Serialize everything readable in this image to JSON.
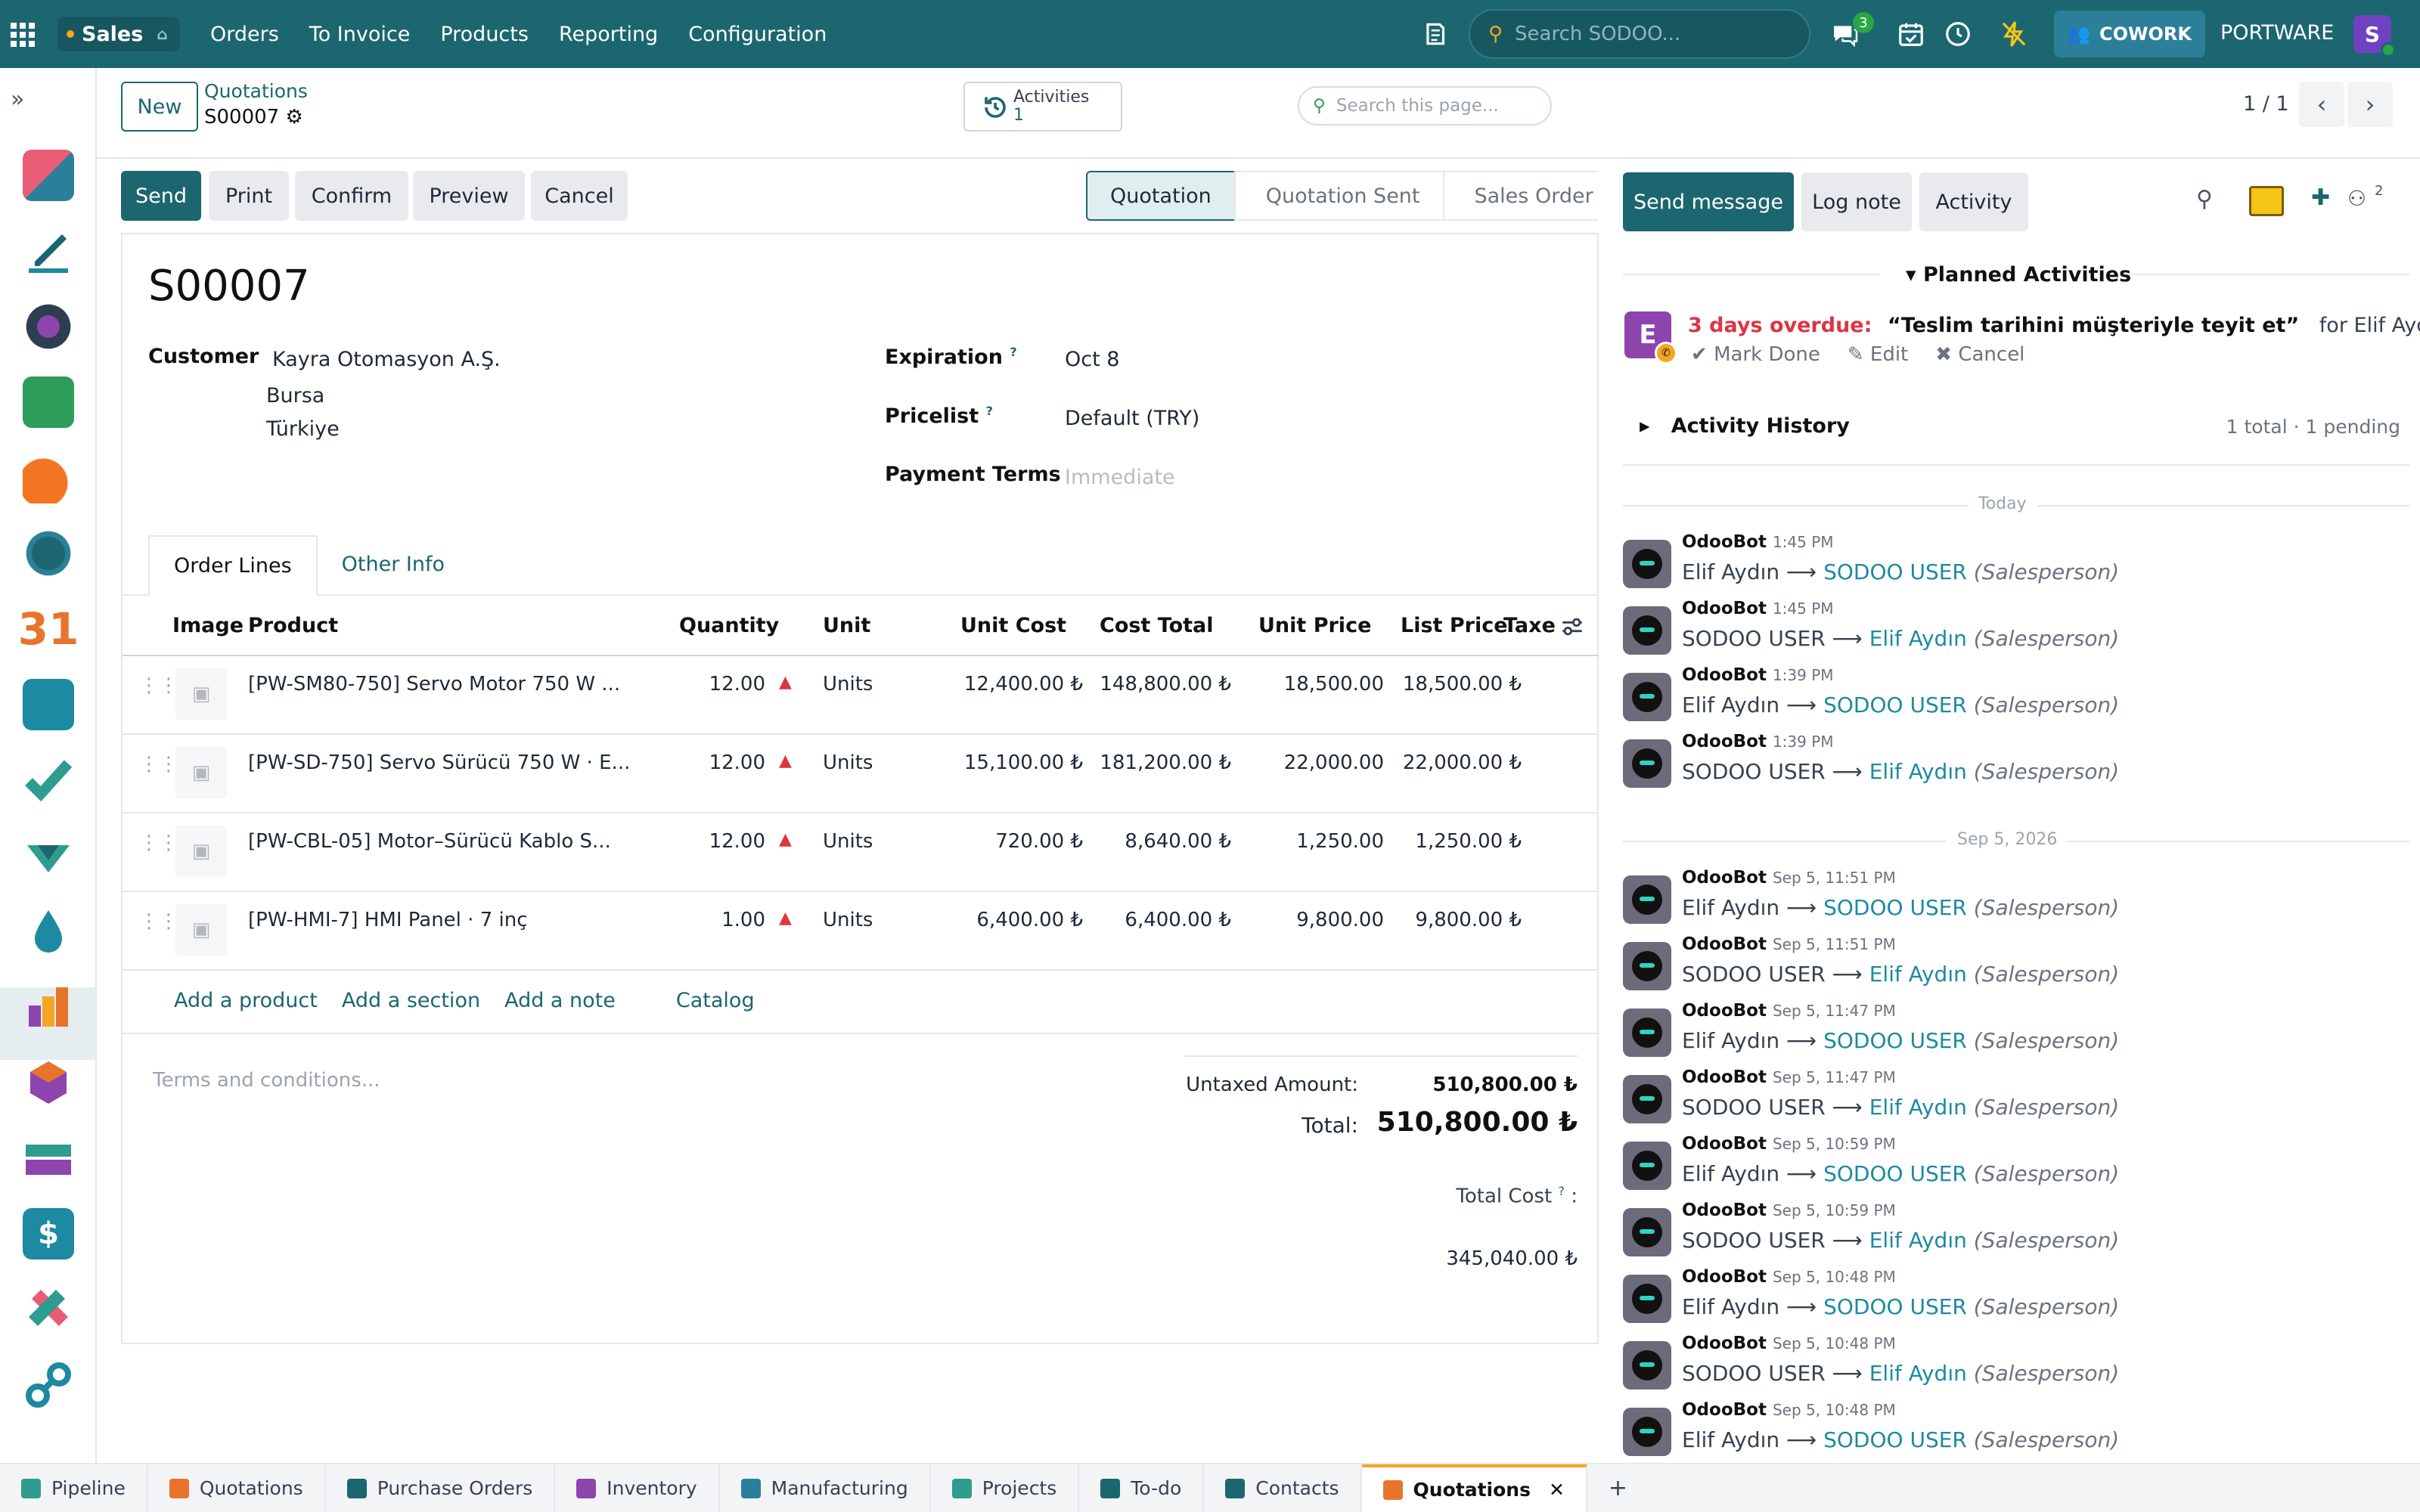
{
  "topbar": {
    "app": "Sales",
    "menu": [
      "Orders",
      "To Invoice",
      "Products",
      "Reporting",
      "Configuration"
    ],
    "search_placeholder": "Search SODOO...",
    "chat_badge": "3",
    "cowork": "COWORK",
    "company": "PORTWARE",
    "avatar": "S"
  },
  "control": {
    "new_label": "New",
    "breadcrumb": "Quotations",
    "record_name": "S00007",
    "activities_label": "Activities",
    "activities_count": "1",
    "page_search": "Search this page...",
    "pager": "1 / 1"
  },
  "actions": {
    "send": "Send",
    "print": "Print",
    "confirm": "Confirm",
    "preview": "Preview",
    "cancel": "Cancel"
  },
  "status": [
    "Quotation",
    "Quotation Sent",
    "Sales Order"
  ],
  "form": {
    "ref": "S00007",
    "customer_label": "Customer",
    "customer_name": "Kayra Otomasyon A.Ş.",
    "customer_city": "Bursa",
    "customer_country": "Türkiye",
    "expiration_label": "Expiration",
    "expiration": "Oct 8",
    "pricelist_label": "Pricelist",
    "pricelist": "Default (TRY)",
    "payment_terms_label": "Payment Terms",
    "payment_terms_placeholder": "Immediate",
    "help_mark": "?"
  },
  "tabs": [
    "Order Lines",
    "Other Info"
  ],
  "table": {
    "headers": [
      "Image",
      "Product",
      "Quantity",
      "Unit",
      "Unit Cost",
      "Cost Total",
      "Unit Price",
      "List Price",
      "Taxe"
    ],
    "rows": [
      {
        "product": "[PW-SM80-750] Servo Motor 750 W ...",
        "qty": "12.00",
        "unit": "Units",
        "unit_cost": "12,400.00 ₺",
        "cost_total": "148,800.00 ₺",
        "unit_price": "18,500.00",
        "list_price": "18,500.00 ₺"
      },
      {
        "product": "[PW-SD-750] Servo Sürücü 750 W · E...",
        "qty": "12.00",
        "unit": "Units",
        "unit_cost": "15,100.00 ₺",
        "cost_total": "181,200.00 ₺",
        "unit_price": "22,000.00",
        "list_price": "22,000.00 ₺"
      },
      {
        "product": "[PW-CBL-05] Motor–Sürücü Kablo S...",
        "qty": "12.00",
        "unit": "Units",
        "unit_cost": "720.00 ₺",
        "cost_total": "8,640.00 ₺",
        "unit_price": "1,250.00",
        "list_price": "1,250.00 ₺"
      },
      {
        "product": "[PW-HMI-7] HMI Panel · 7 inç",
        "qty": "1.00",
        "unit": "Units",
        "unit_cost": "6,400.00 ₺",
        "cost_total": "6,400.00 ₺",
        "unit_price": "9,800.00",
        "list_price": "9,800.00 ₺"
      }
    ],
    "add_product": "Add a product",
    "add_section": "Add a section",
    "add_note": "Add a note",
    "catalog": "Catalog"
  },
  "footer": {
    "terms_placeholder": "Terms and conditions...",
    "untaxed_label": "Untaxed Amount:",
    "untaxed": "510,800.00 ₺",
    "total_label": "Total:",
    "total": "510,800.00 ₺",
    "total_cost_label": "Total Cost",
    "total_cost_colon": ":",
    "total_cost": "345,040.00 ₺"
  },
  "chatter": {
    "send_message": "Send message",
    "log_note": "Log note",
    "activity": "Activity",
    "followers": "2",
    "planned_title": "Planned Activities",
    "overdue": "3 days overdue:",
    "activity_title": "“Teslim tarihini müşteriyle teyit et”",
    "activity_for": "for Elif Aydın",
    "activity_avatar": "E",
    "mark_done": "Mark Done",
    "edit": "Edit",
    "cancel": "Cancel",
    "history_title": "Activity History",
    "history_summary": "1 total · 1 pending",
    "sep_today": "Today",
    "sep_date": "Sep 5, 2026",
    "author": "OdooBot",
    "role": "(Salesperson)",
    "messages_today": [
      {
        "time": "1:45 PM",
        "from": "Elif Aydın",
        "to": "SODOO USER"
      },
      {
        "time": "1:45 PM",
        "from": "SODOO USER",
        "to": "Elif Aydın"
      },
      {
        "time": "1:39 PM",
        "from": "Elif Aydın",
        "to": "SODOO USER"
      },
      {
        "time": "1:39 PM",
        "from": "SODOO USER",
        "to": "Elif Aydın"
      }
    ],
    "messages_older": [
      {
        "time": "Sep 5, 11:51 PM",
        "from": "Elif Aydın",
        "to": "SODOO USER"
      },
      {
        "time": "Sep 5, 11:51 PM",
        "from": "SODOO USER",
        "to": "Elif Aydın"
      },
      {
        "time": "Sep 5, 11:47 PM",
        "from": "Elif Aydın",
        "to": "SODOO USER"
      },
      {
        "time": "Sep 5, 11:47 PM",
        "from": "SODOO USER",
        "to": "Elif Aydın"
      },
      {
        "time": "Sep 5, 10:59 PM",
        "from": "Elif Aydın",
        "to": "SODOO USER"
      },
      {
        "time": "Sep 5, 10:59 PM",
        "from": "SODOO USER",
        "to": "Elif Aydın"
      },
      {
        "time": "Sep 5, 10:48 PM",
        "from": "Elif Aydın",
        "to": "SODOO USER"
      },
      {
        "time": "Sep 5, 10:48 PM",
        "from": "SODOO USER",
        "to": "Elif Aydın"
      },
      {
        "time": "Sep 5, 10:48 PM",
        "from": "Elif Aydın",
        "to": "SODOO USER"
      }
    ]
  },
  "taskbar": [
    {
      "label": "Pipeline",
      "color": "#2e9c8f"
    },
    {
      "label": "Quotations",
      "color": "#e8742b"
    },
    {
      "label": "Purchase Orders",
      "color": "#1c6670"
    },
    {
      "label": "Inventory",
      "color": "#8e44ad"
    },
    {
      "label": "Manufacturing",
      "color": "#2c7f99"
    },
    {
      "label": "Projects",
      "color": "#2e9c8f"
    },
    {
      "label": "To-do",
      "color": "#1c6670"
    },
    {
      "label": "Contacts",
      "color": "#1c6670"
    },
    {
      "label": "Quotations",
      "color": "#e8742b",
      "active": true
    }
  ],
  "colors": {
    "brand": "#1c6670",
    "overdue": "#dc3545",
    "link": "#1c8aa0"
  }
}
